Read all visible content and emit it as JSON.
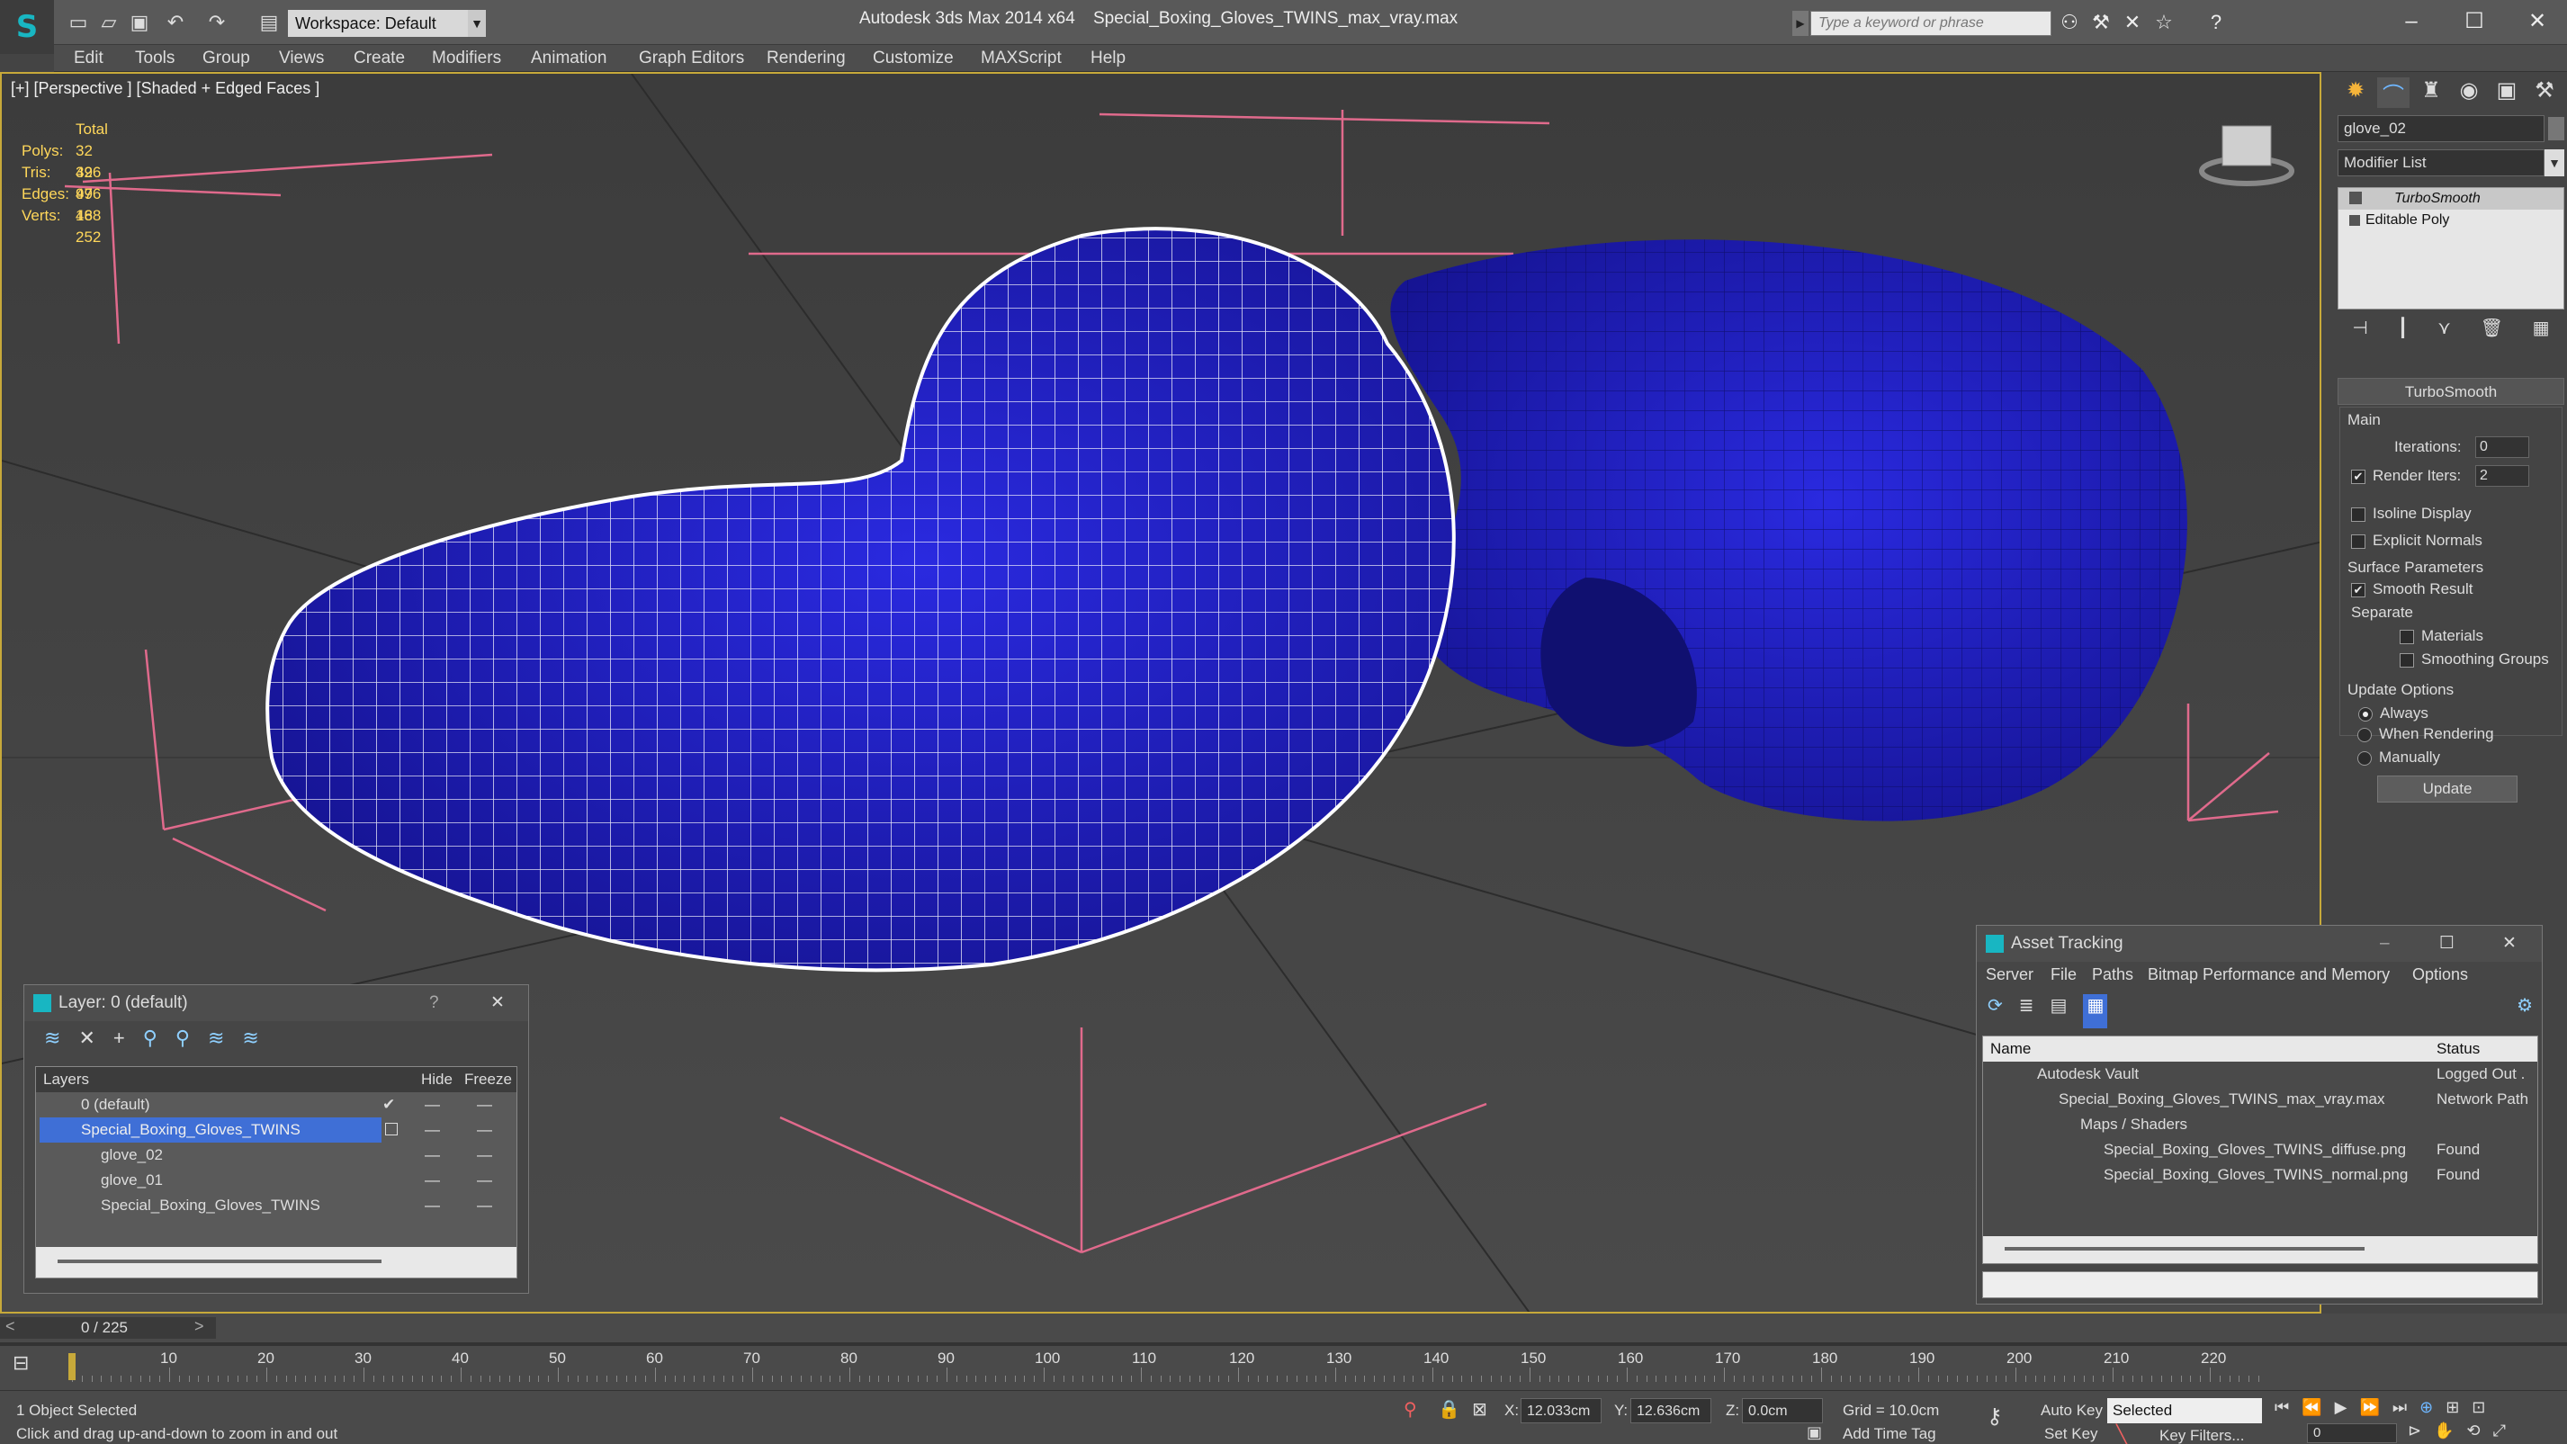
{
  "titlebar": {
    "app": "Autodesk 3ds Max  2014 x64",
    "file": "Special_Boxing_Gloves_TWINS_max_vray.max",
    "workspace": "Workspace: Default",
    "search_placeholder": "Type a keyword or phrase"
  },
  "menus": [
    "Edit",
    "Tools",
    "Group",
    "Views",
    "Create",
    "Modifiers",
    "Animation",
    "Graph Editors",
    "Rendering",
    "Customize",
    "MAXScript",
    "Help"
  ],
  "viewport": {
    "label": "[+] [Perspective ] [Shaded + Edged Faces ]",
    "stats": {
      "header": "Total",
      "rows": [
        {
          "k": "Polys:",
          "v": "32 496"
        },
        {
          "k": "Tris:",
          "v": "32 496"
        },
        {
          "k": "Edges:",
          "v": "97 488"
        },
        {
          "k": "Verts:",
          "v": "16 252"
        }
      ]
    },
    "accent": "#1b16c8"
  },
  "command_panel": {
    "object_name": "glove_02",
    "modifier_list": "Modifier List",
    "stack": [
      "TurboSmooth",
      "Editable Poly"
    ],
    "rollout": "TurboSmooth",
    "main": "Main",
    "iterations_label": "Iterations:",
    "iterations": "0",
    "render_iters_label": "Render Iters:",
    "render_iters": "2",
    "isoline": "Isoline Display",
    "explicit": "Explicit Normals",
    "surface": "Surface Parameters",
    "smooth": "Smooth Result",
    "separate": "Separate",
    "materials": "Materials",
    "smoothing": "Smoothing Groups",
    "update_options": "Update Options",
    "always": "Always",
    "when_rendering": "When Rendering",
    "manually": "Manually",
    "update": "Update"
  },
  "layer_dialog": {
    "title": "Layer: 0 (default)",
    "help": "?",
    "close": "✕",
    "cols": [
      "Layers",
      "Hide",
      "Freeze"
    ],
    "rows": [
      "0 (default)",
      "Special_Boxing_Gloves_TWINS",
      "glove_02",
      "glove_01",
      "Special_Boxing_Gloves_TWINS"
    ]
  },
  "asset_dialog": {
    "title": "Asset Tracking",
    "menus": [
      "Server",
      "File",
      "Paths",
      "Bitmap Performance and Memory",
      "Options"
    ],
    "cols": [
      "Name",
      "Status"
    ],
    "rows": [
      {
        "name": "Autodesk Vault",
        "status": "Logged Out ."
      },
      {
        "name": "Special_Boxing_Gloves_TWINS_max_vray.max",
        "status": "Network Path"
      },
      {
        "name": "Maps / Shaders",
        "status": ""
      },
      {
        "name": "Special_Boxing_Gloves_TWINS_diffuse.png",
        "status": "Found"
      },
      {
        "name": "Special_Boxing_Gloves_TWINS_normal.png",
        "status": "Found"
      }
    ]
  },
  "timeline": {
    "frame": "0 / 225",
    "ticks": [
      "10",
      "20",
      "30",
      "40",
      "50",
      "60",
      "70",
      "80",
      "90",
      "100",
      "110",
      "120",
      "130",
      "140",
      "150",
      "160",
      "170",
      "180",
      "190",
      "200",
      "210",
      "220"
    ]
  },
  "status": {
    "selected": "1 Object Selected",
    "hint": "Click and drag up-and-down to zoom in and out",
    "x_label": "X:",
    "x": "12.033cm",
    "y_label": "Y:",
    "y": "12.636cm",
    "z_label": "Z:",
    "z": "0.0cm",
    "grid": "Grid = 10.0cm",
    "auto_key": "Auto Key",
    "set_key": "Set Key",
    "selected_dd": "Selected",
    "key_filters": "Key Filters...",
    "add_time_tag": "Add Time Tag",
    "frame_field": "0"
  }
}
